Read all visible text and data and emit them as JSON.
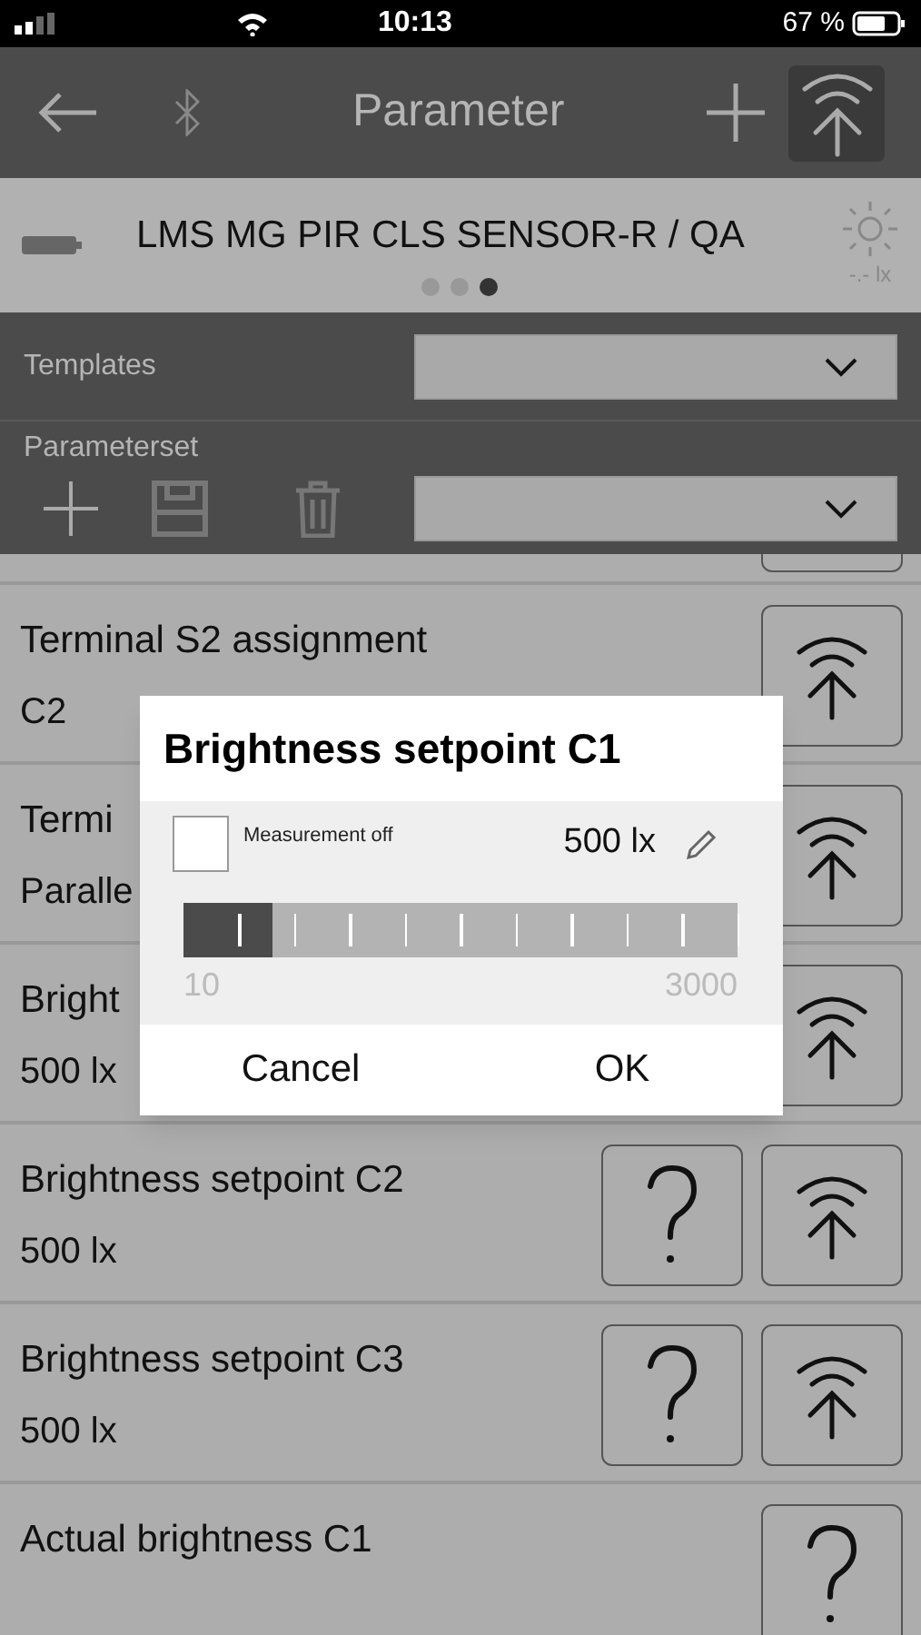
{
  "status_bar": {
    "time": "10:13",
    "battery": "67 %"
  },
  "header": {
    "title": "Parameter"
  },
  "device": {
    "name": "LMS MG PIR CLS SENSOR-R / QA",
    "reading": "-.- lx",
    "pages": [
      {
        "selected": false
      },
      {
        "selected": false
      },
      {
        "selected": true
      }
    ]
  },
  "templates": {
    "label": "Templates"
  },
  "parameterset": {
    "label": "Parameterset"
  },
  "rows": [
    {
      "name": "Terminal S2 assignment",
      "value": "C2",
      "buttons": [
        {
          "kind": "upload"
        }
      ]
    },
    {
      "name": "Termi",
      "value": "Paralle",
      "buttons": [
        {
          "kind": "upload"
        }
      ]
    },
    {
      "name": "Bright",
      "value": "500 lx",
      "buttons": [
        {
          "kind": "upload"
        }
      ]
    },
    {
      "name": "Brightness setpoint C2",
      "value": "500 lx",
      "buttons": [
        {
          "kind": "help"
        },
        {
          "kind": "upload"
        }
      ]
    },
    {
      "name": "Brightness setpoint C3",
      "value": "500 lx",
      "buttons": [
        {
          "kind": "help"
        },
        {
          "kind": "upload"
        }
      ]
    },
    {
      "name": "Actual brightness C1",
      "buttons": [
        {
          "kind": "help"
        }
      ]
    }
  ],
  "dialog": {
    "title": "Brightness setpoint C1",
    "checkbox": {
      "label": "Measurement off",
      "checked": false
    },
    "value": "500 lx",
    "slider": {
      "level": 0.16,
      "min": "10",
      "max": "3000"
    },
    "buttons": [
      "Cancel",
      "OK"
    ]
  }
}
